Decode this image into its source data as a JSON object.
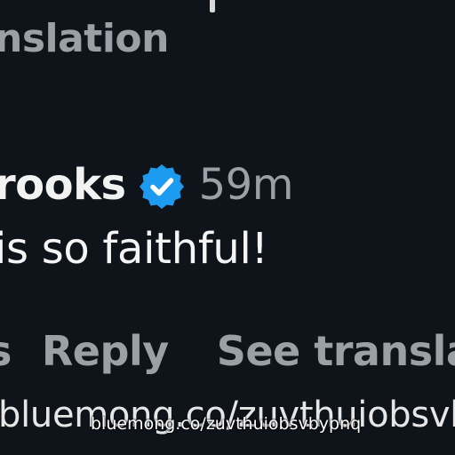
{
  "top": {
    "see_translation": "nslation"
  },
  "comment": {
    "username": "rooks",
    "verified_icon": "verified-badge-icon",
    "timestamp": "59m",
    "text": "is so faithful!"
  },
  "actions": {
    "fragment": "s",
    "reply": "Reply",
    "see_translation": "See translat"
  },
  "watermark": {
    "large": "bluemong.co/zuvthuiobsvbypnq",
    "small": "bluemong.co/zuvthuiobsvbypnq"
  },
  "colors": {
    "background": "#0f131a",
    "text_primary": "#f2f2f2",
    "text_secondary": "#9aa0a6",
    "verified_blue": "#1d9bf0"
  }
}
